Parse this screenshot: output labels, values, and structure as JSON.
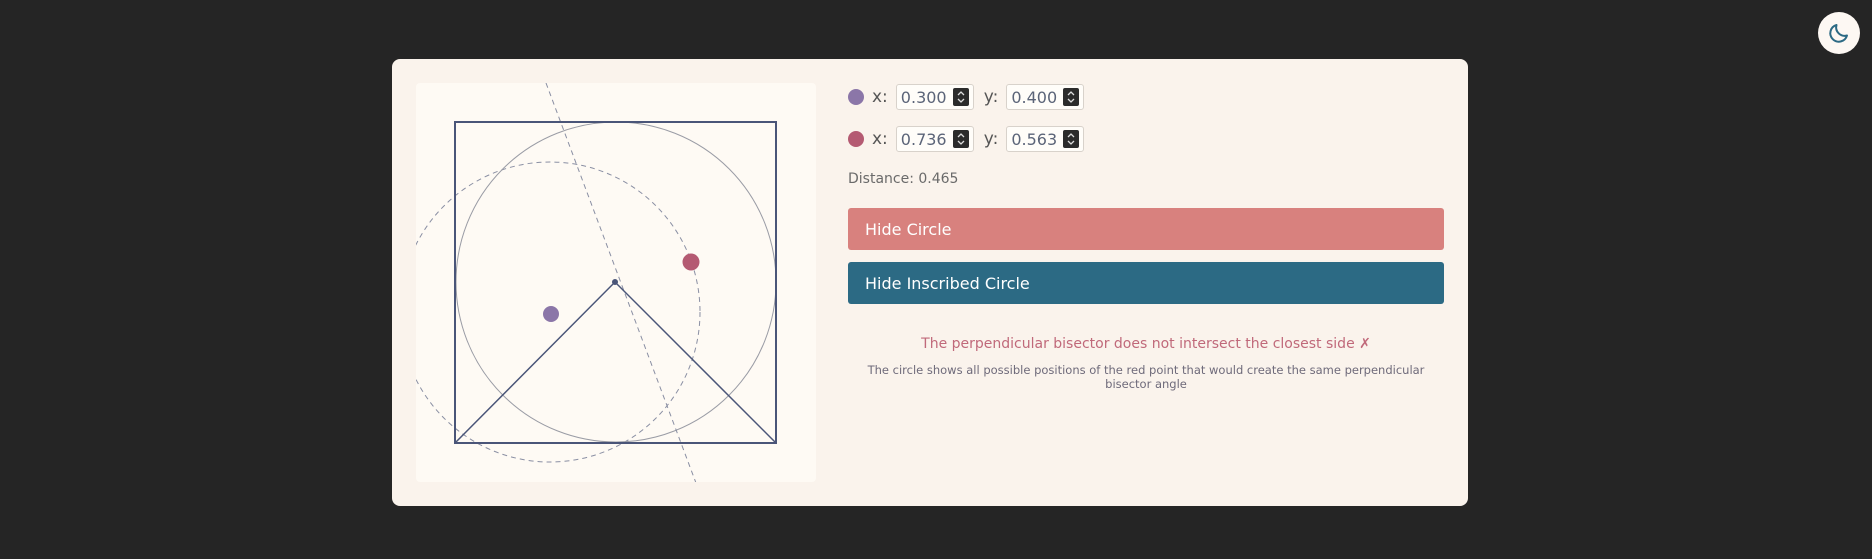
{
  "header": {
    "theme_icon": "moon-icon"
  },
  "points": [
    {
      "color": "#8b76a8",
      "x_label": "x:",
      "y_label": "y:",
      "x": "0.300",
      "y": "0.400"
    },
    {
      "color": "#b45a72",
      "x_label": "x:",
      "y_label": "y:",
      "x": "0.736",
      "y": "0.563"
    }
  ],
  "distance": "Distance: 0.465",
  "buttons": {
    "hide_circle": "Hide Circle",
    "hide_inscribed": "Hide Inscribed Circle"
  },
  "colors": {
    "button_circle": "#d8817e",
    "button_inscribed": "#2c6a84",
    "status_text": "#c0697a",
    "square_stroke": "#4a5578"
  },
  "status": "The perpendicular bisector does not intersect the closest side ✗",
  "note": "The circle shows all possible positions of the red point that would create the same perpendicular bisector angle"
}
